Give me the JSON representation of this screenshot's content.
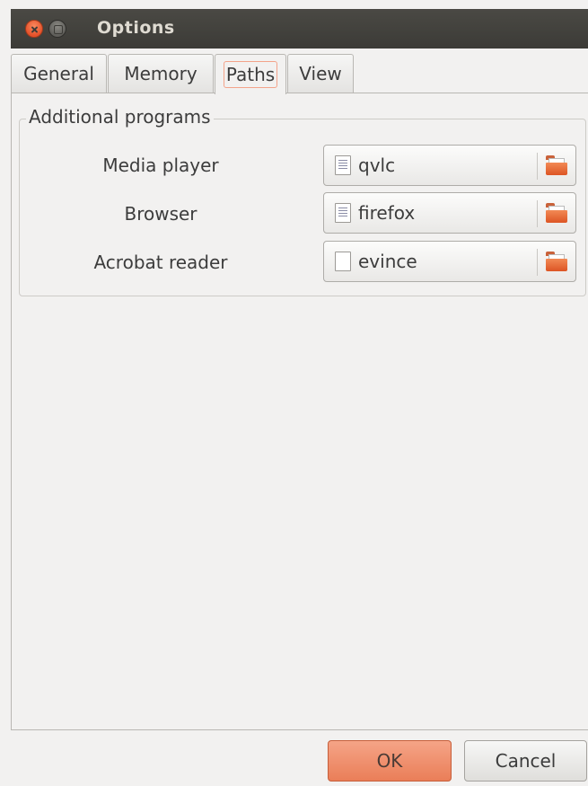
{
  "window": {
    "title": "Options"
  },
  "tabs": [
    {
      "label": "General"
    },
    {
      "label": "Memory"
    },
    {
      "label": "Paths",
      "active": true
    },
    {
      "label": "View"
    }
  ],
  "frame": {
    "label": "Additional programs",
    "rows": [
      {
        "label": "Media player",
        "value": "qvlc",
        "icon": "text-file-icon"
      },
      {
        "label": "Browser",
        "value": "firefox",
        "icon": "text-file-icon"
      },
      {
        "label": "Acrobat reader",
        "value": "evince",
        "icon": "blank-file-icon"
      }
    ]
  },
  "buttons": {
    "ok": "OK",
    "cancel": "Cancel"
  },
  "colors": {
    "accent": "#ea7e58",
    "titlebar": "#3c3b37",
    "background": "#f2f1f0"
  }
}
